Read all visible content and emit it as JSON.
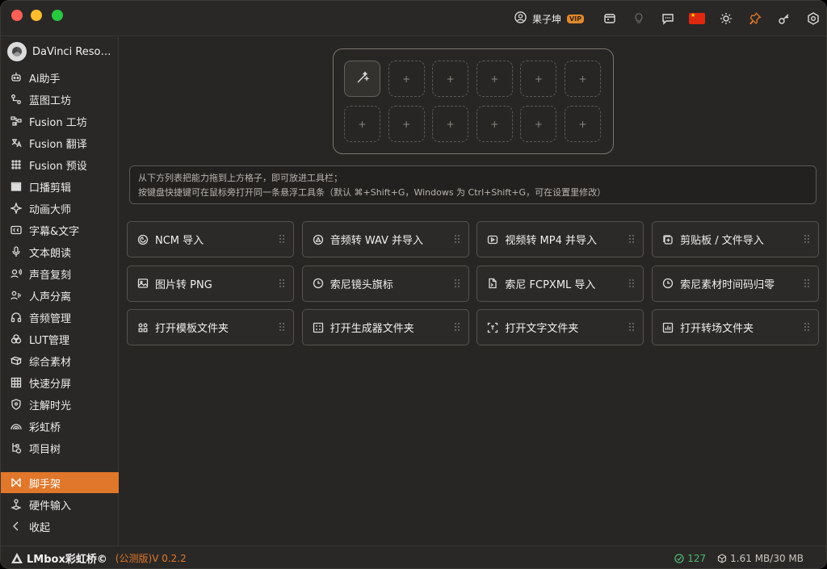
{
  "titlebar": {
    "user_name": "果子坤",
    "vip_badge": "VIP",
    "icons": [
      "store-icon",
      "lightbulb-icon",
      "message-icon",
      "china-flag-icon",
      "sun-icon",
      "pin-icon",
      "key-icon",
      "settings-icon"
    ]
  },
  "sidebar": {
    "app_name": "DaVinci Resolve",
    "items": [
      {
        "label": "Ai助手",
        "icon": "robot-icon"
      },
      {
        "label": "蓝图工坊",
        "icon": "blueprint-icon"
      },
      {
        "label": "Fusion 工坊",
        "icon": "nodes-icon"
      },
      {
        "label": "Fusion 翻译",
        "icon": "translate-icon"
      },
      {
        "label": "Fusion 预设",
        "icon": "preset-grid-icon"
      },
      {
        "label": "口播剪辑",
        "icon": "clapper-icon"
      },
      {
        "label": "动画大师",
        "icon": "sparkle-icon"
      },
      {
        "label": "字幕&文字",
        "icon": "cc-icon"
      },
      {
        "label": "文本朗读",
        "icon": "microphone-icon"
      },
      {
        "label": "声音复刻",
        "icon": "voice-clone-icon"
      },
      {
        "label": "人声分离",
        "icon": "vocal-split-icon"
      },
      {
        "label": "音频管理",
        "icon": "headphones-icon"
      },
      {
        "label": "LUT管理",
        "icon": "lut-icon"
      },
      {
        "label": "综合素材",
        "icon": "assets-icon"
      },
      {
        "label": "快速分屏",
        "icon": "split-screen-icon"
      },
      {
        "label": "注解时光",
        "icon": "shield-icon"
      },
      {
        "label": "彩虹桥",
        "icon": "rainbow-icon"
      },
      {
        "label": "项目树",
        "icon": "tree-icon"
      },
      {
        "label": "脚手架",
        "icon": "scaffold-icon"
      },
      {
        "label": "硬件输入",
        "icon": "joystick-icon"
      },
      {
        "label": "收起",
        "icon": "chevron-left-icon"
      }
    ],
    "active": "脚手架"
  },
  "toolbar_slots": {
    "plus": "+",
    "rows": 2,
    "cols": 6
  },
  "hint": {
    "line1": "从下方列表把能力拖到上方格子，即可放进工具栏；",
    "line2": "按键盘快捷键可在鼠标旁打开同一条悬浮工具条（默认 ⌘+Shift+G，Windows 为 Ctrl+Shift+G，可在设置里修改）"
  },
  "tools": [
    {
      "label": "NCM 导入",
      "icon": "ncm-icon"
    },
    {
      "label": "音频转 WAV 并导入",
      "icon": "audio-convert-icon"
    },
    {
      "label": "视频转 MP4 并导入",
      "icon": "video-convert-icon"
    },
    {
      "label": "剪贴板 / 文件导入",
      "icon": "clipboard-icon"
    },
    {
      "label": "图片转 PNG",
      "icon": "image-icon"
    },
    {
      "label": "索尼镜头旗标",
      "icon": "clock-icon"
    },
    {
      "label": "索尼 FCPXML 导入",
      "icon": "document-icon"
    },
    {
      "label": "索尼素材时间码归零",
      "icon": "timecode-icon"
    },
    {
      "label": "打开模板文件夹",
      "icon": "template-icon"
    },
    {
      "label": "打开生成器文件夹",
      "icon": "generator-icon"
    },
    {
      "label": "打开文字文件夹",
      "icon": "text-frame-icon"
    },
    {
      "label": "打开转场文件夹",
      "icon": "transition-icon"
    }
  ],
  "statusbar": {
    "brand": "LMbox彩虹桥©",
    "version": "(公测版)V 0.2.2",
    "count": "127",
    "memory": "1.61 MB/30 MB"
  },
  "colors": {
    "accent": "#e0772b",
    "background": "#282624",
    "count_green": "#4fb874"
  }
}
